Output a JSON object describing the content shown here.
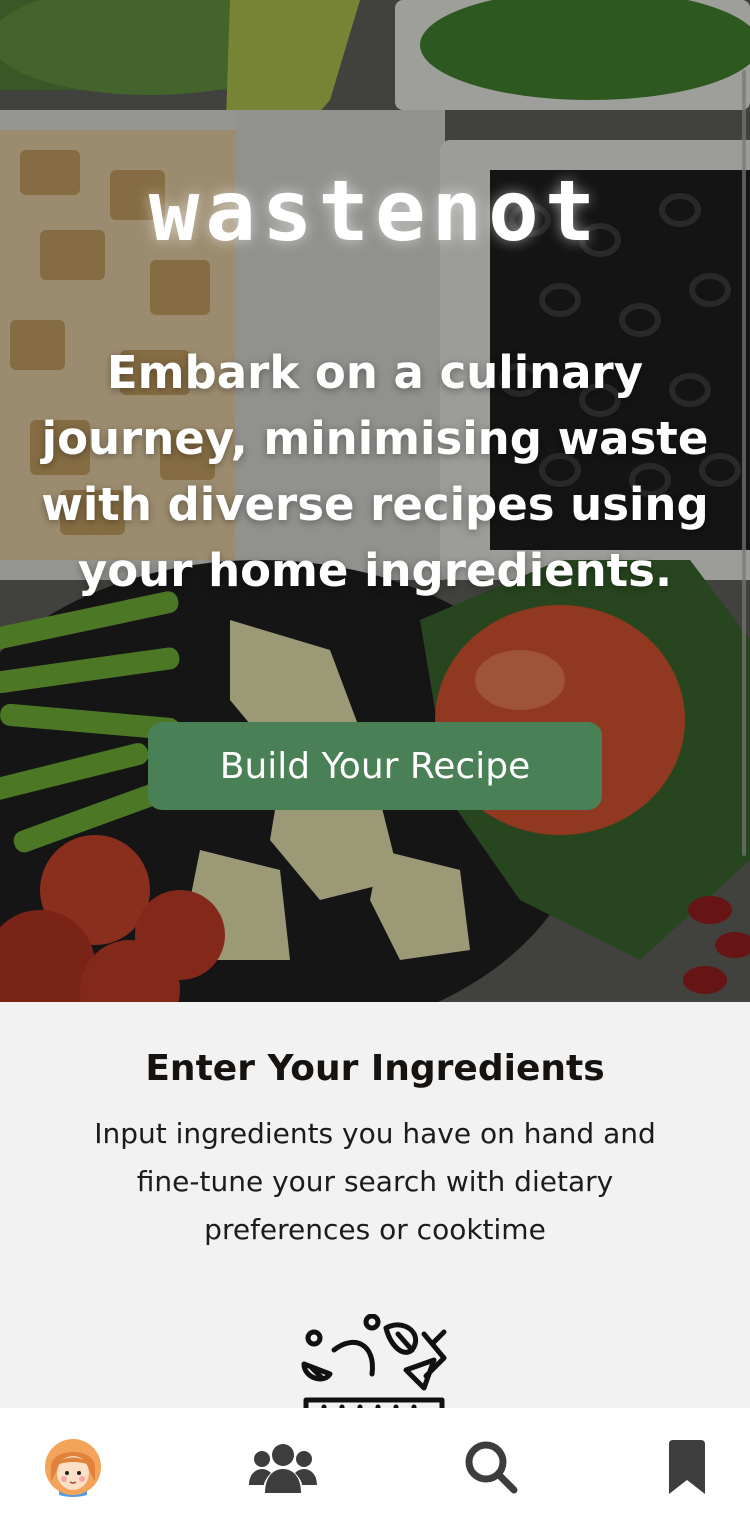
{
  "hero": {
    "brand": "wastenot",
    "tagline": "Embark on a culinary journey, minimising waste with diverse recipes using your home ingredients.",
    "cta_label": "Build Your Recipe",
    "cta_color": "#4a8055"
  },
  "section": {
    "title": "Enter Your Ingredients",
    "description": "Input ingredients you have on hand and fine-tune your search with dietary preferences or cooktime",
    "illustration_icon": "ingredients-basket-icon"
  },
  "bottom_nav": {
    "items": [
      {
        "icon": "profile-avatar-icon"
      },
      {
        "icon": "community-icon"
      },
      {
        "icon": "search-icon"
      },
      {
        "icon": "bookmark-icon"
      }
    ],
    "icon_color": "#3d3d3d"
  }
}
